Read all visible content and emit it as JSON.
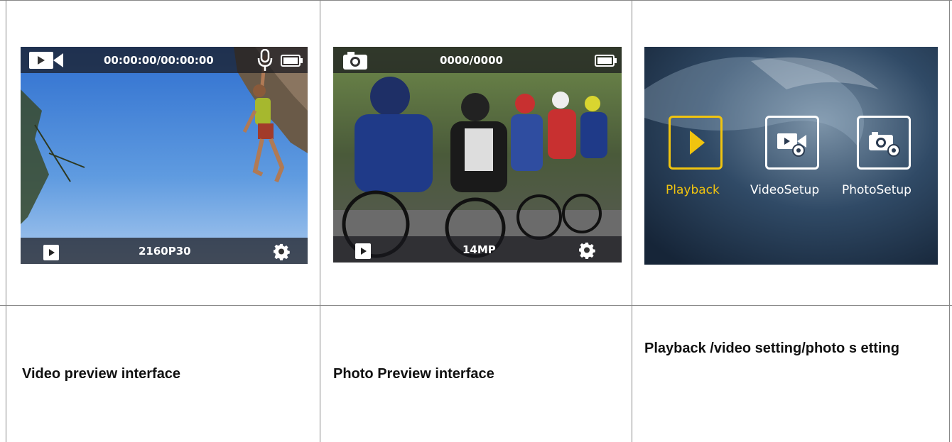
{
  "video_preview": {
    "timer": "00:00:00/00:00:00",
    "resolution": "2160P30",
    "icons": [
      "video-camera-icon",
      "microphone-icon",
      "battery-icon",
      "play-icon",
      "gear-icon"
    ],
    "caption": "Video preview interface"
  },
  "photo_preview": {
    "counter": "0000/0000",
    "resolution": "14MP",
    "icons": [
      "camera-icon",
      "battery-icon",
      "play-icon",
      "gear-icon"
    ],
    "caption": "Photo Preview interface"
  },
  "menu": {
    "items": [
      {
        "label": "Playback",
        "icon": "play-icon",
        "active": true
      },
      {
        "label": "VideoSetup",
        "icon": "video-settings-icon",
        "active": false
      },
      {
        "label": "PhotoSetup",
        "icon": "camera-settings-icon",
        "active": false
      }
    ],
    "caption": "Playback /video setting/photo s etting",
    "accent": "#f1c40f"
  }
}
